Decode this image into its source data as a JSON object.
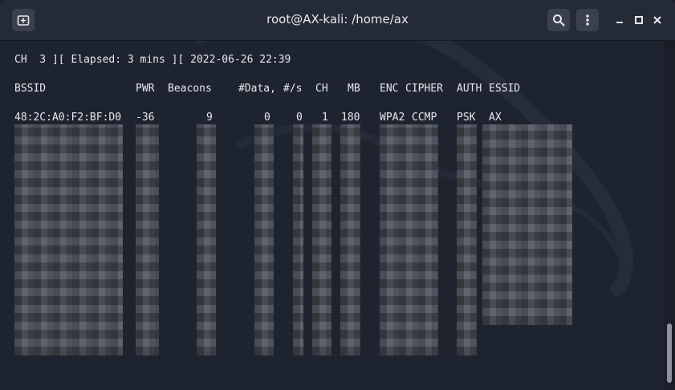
{
  "window": {
    "title": "root@AX-kali: /home/ax",
    "new_tab_icon": "new-tab-icon",
    "search_icon": "search-icon",
    "menu_icon": "kebab-menu-icon",
    "minimize_icon": "minimize-icon",
    "maximize_icon": "maximize-icon",
    "close_icon": "close-icon"
  },
  "terminal": {
    "status_line": "CH  3 ][ Elapsed: 3 mins ][ 2022-06-26 22:39",
    "headers": {
      "bssid": "BSSID",
      "pwr": "PWR",
      "beacons": "Beacons",
      "data": "#Data,",
      "per_s": "#/s",
      "ch": "CH",
      "mb": "MB",
      "enc": "ENC",
      "cipher": "CIPHER",
      "auth": "AUTH",
      "essid": "ESSID"
    },
    "row1": {
      "bssid": "48:2C:A0:F2:BF:D0",
      "pwr": "-36",
      "beacons": "9",
      "data": "0",
      "per_s": "0",
      "ch": "1",
      "mb": "180",
      "enc": "WPA2",
      "cipher": "CCMP",
      "auth": "PSK",
      "essid": "AX"
    }
  },
  "colors": {
    "background": "#1e2330",
    "titlebar": "#242a36",
    "text": "#e6e8ec",
    "blur": "#4a4f59"
  }
}
